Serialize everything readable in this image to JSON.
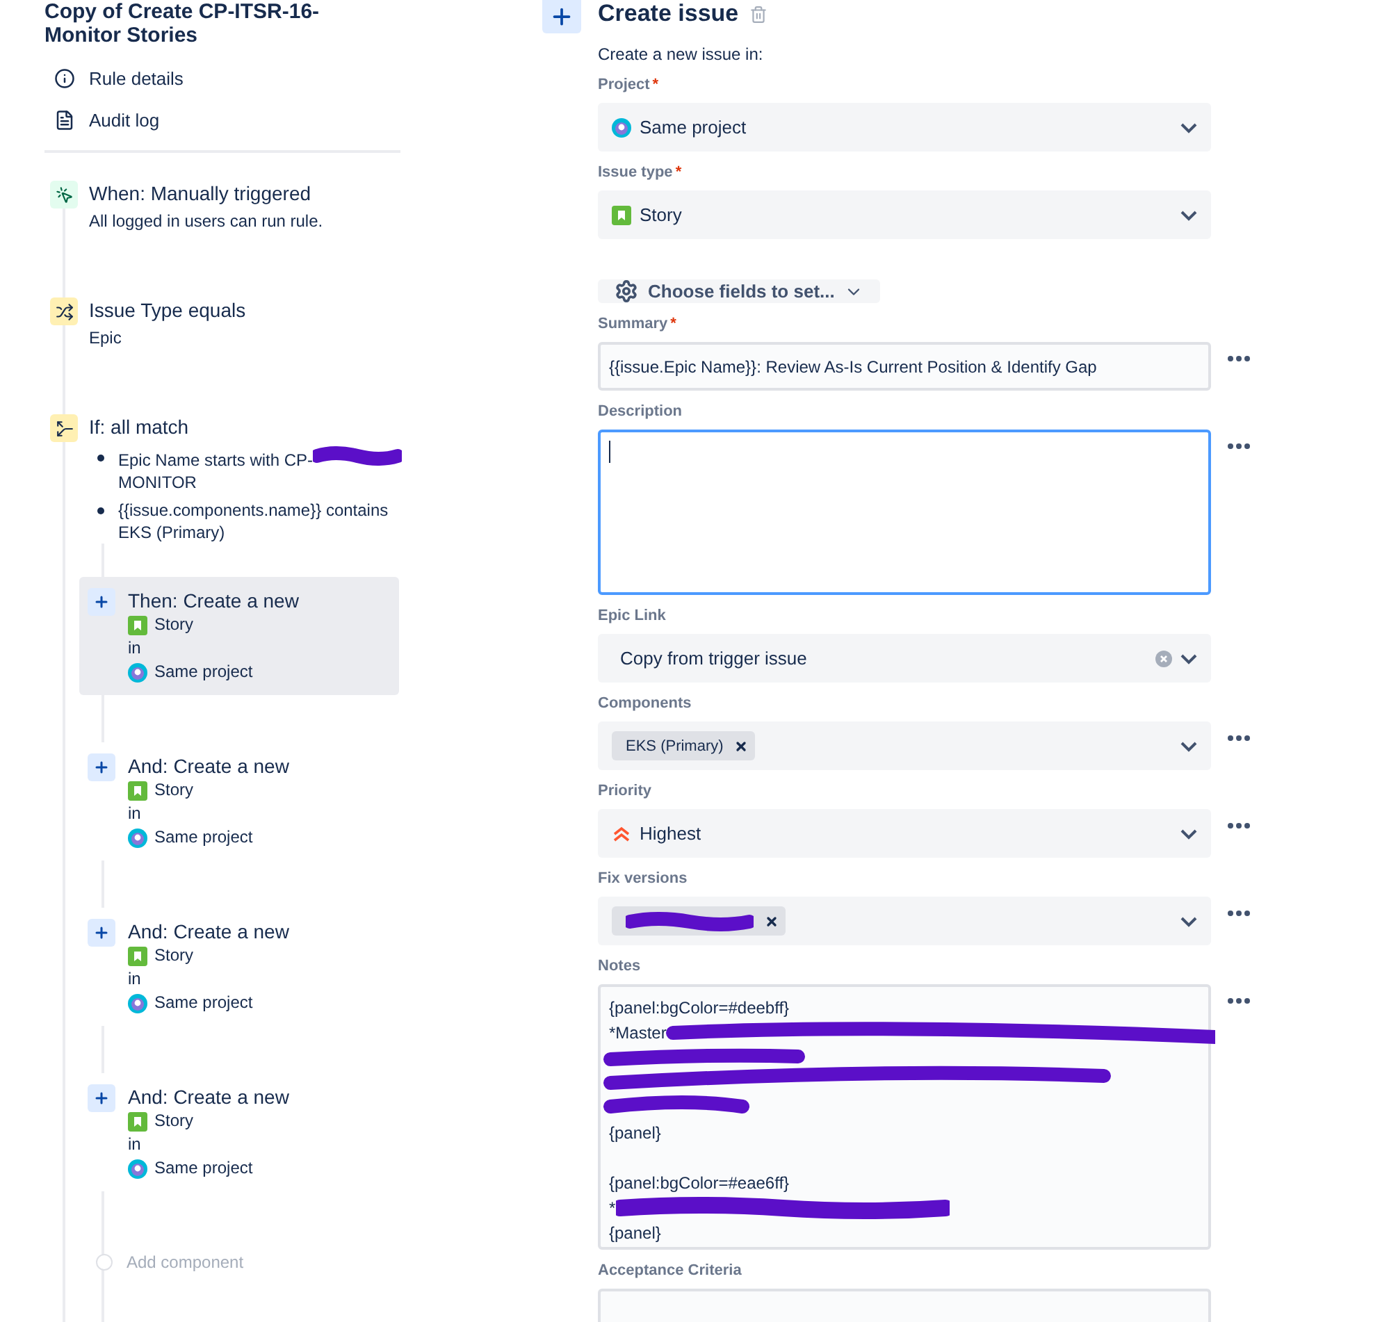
{
  "rule": {
    "title": "Copy of Create CP-ITSR-16-Monitor Stories",
    "nav": [
      {
        "kind": "info",
        "label": "Rule details"
      },
      {
        "kind": "log",
        "label": "Audit log"
      }
    ],
    "steps": [
      {
        "kind": "trigger",
        "title": "When: Manually triggered",
        "subtitle": "All logged in users can run rule."
      },
      {
        "kind": "condition",
        "title": "Issue Type equals",
        "subtitle": "Epic"
      },
      {
        "kind": "branch",
        "title": "If: all match",
        "items": [
          {
            "text": "Epic Name starts with CP-",
            "redacted": true,
            "text_after": "MONITOR"
          },
          {
            "text": "{{issue.components.name}} contains EKS (Primary)",
            "redacted": false
          }
        ]
      }
    ],
    "actions": [
      {
        "title": "Then: Create a new",
        "selected": true,
        "issue_type": "Story",
        "joiner": "in",
        "project": "Same project"
      },
      {
        "title": "And: Create a new",
        "selected": false,
        "issue_type": "Story",
        "joiner": "in",
        "project": "Same project"
      },
      {
        "title": "And: Create a new",
        "selected": false,
        "issue_type": "Story",
        "joiner": "in",
        "project": "Same project"
      },
      {
        "title": "And: Create a new",
        "selected": false,
        "issue_type": "Story",
        "joiner": "in",
        "project": "Same project"
      }
    ],
    "add_component": "Add component"
  },
  "editor": {
    "title": "Create issue",
    "intro": "Create a new issue in:",
    "fields": [
      {
        "kind": "project",
        "label": "Project",
        "required_mark": "*",
        "value": "Same project",
        "has_menu": false,
        "clearable": false
      },
      {
        "kind": "issuetype",
        "label": "Issue type",
        "required_mark": "*",
        "value": "Story",
        "has_menu": false,
        "clearable": false
      },
      {
        "kind": "divider"
      },
      {
        "kind": "button",
        "label": "Choose fields to set..."
      },
      {
        "kind": "text",
        "label": "Summary",
        "required_mark": "*",
        "value": "{{issue.Epic Name}}: Review As-Is Current Position & Identify Gap",
        "has_menu": true
      },
      {
        "kind": "textarea",
        "label": "Description",
        "focused": true,
        "has_menu": true
      },
      {
        "kind": "select",
        "label": "Epic Link",
        "value": "Copy from trigger issue",
        "has_menu": false,
        "clearable": true
      },
      {
        "kind": "tags",
        "label": "Components",
        "tags": [
          {
            "text": "EKS (Primary)",
            "redacted": false
          }
        ],
        "has_menu": true
      },
      {
        "kind": "priority",
        "label": "Priority",
        "value": "Highest",
        "has_menu": true,
        "clearable": false
      },
      {
        "kind": "tags",
        "label": "Fix versions",
        "tags": [
          {
            "redacted": true
          }
        ],
        "has_menu": true
      },
      {
        "kind": "notes",
        "label": "Notes",
        "has_menu": true,
        "lines": [
          {
            "kind": "plain",
            "text": "{panel:bgColor=#deebff}"
          },
          {
            "kind": "block",
            "text": "*Master"
          },
          {
            "kind": "plain",
            "text": "{panel}"
          },
          {
            "kind": "blank"
          },
          {
            "kind": "plain",
            "text": "{panel:bgColor=#eae6ff}"
          },
          {
            "kind": "inline",
            "text": "*"
          },
          {
            "kind": "plain",
            "text": "{panel}"
          }
        ]
      },
      {
        "kind": "empty",
        "label": "Acceptance Criteria"
      }
    ]
  }
}
